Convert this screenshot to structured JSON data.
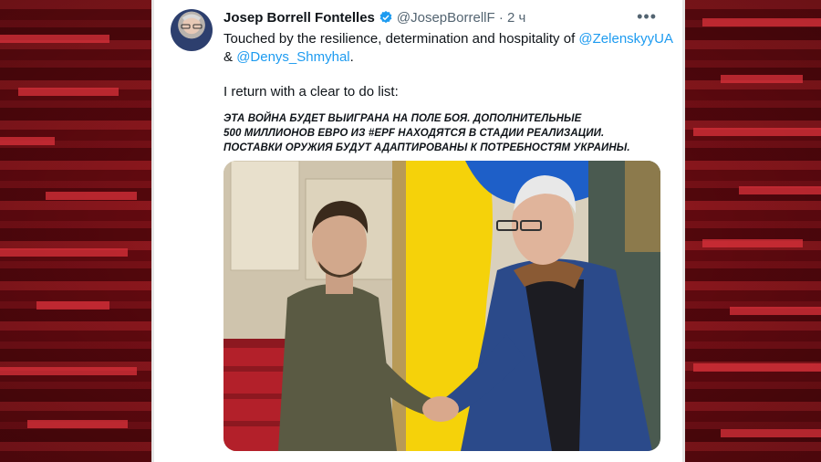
{
  "tweet": {
    "author_name": "Josep Borrell Fontelles",
    "handle": "@JosepBorrellF",
    "separator": "·",
    "time": "2 ч",
    "text_line1": "Touched by the resilience, determination and hospitality of",
    "mention1": "@ZelenskyyUA",
    "amp": "&",
    "mention2": "@Denys_Shmyhal",
    "period": ".",
    "text_line2": "I return with a clear to do list:",
    "overlay_line1": "ЭТА ВОЙНА БУДЕТ ВЫИГРАНА НА ПОЛЕ БОЯ. ДОПОЛНИТЕЛЬНЫЕ",
    "overlay_line2": "500 МИЛЛИОНОВ ЕВРО ИЗ #EPF НАХОДЯТСЯ В СТАДИИ РЕАЛИЗАЦИИ.",
    "overlay_line3": "ПОСТАВКИ ОРУЖИЯ БУДУТ АДАПТИРОВАНЫ К ПОТРЕБНОСТЯМ УКРАИНЫ.",
    "more_icon": "more-icon",
    "verified_icon": "verified-badge-icon"
  },
  "colors": {
    "link": "#1d9bf0",
    "verified": "#1d9bf0",
    "muted": "#536471",
    "background_red": "#b8101c"
  }
}
